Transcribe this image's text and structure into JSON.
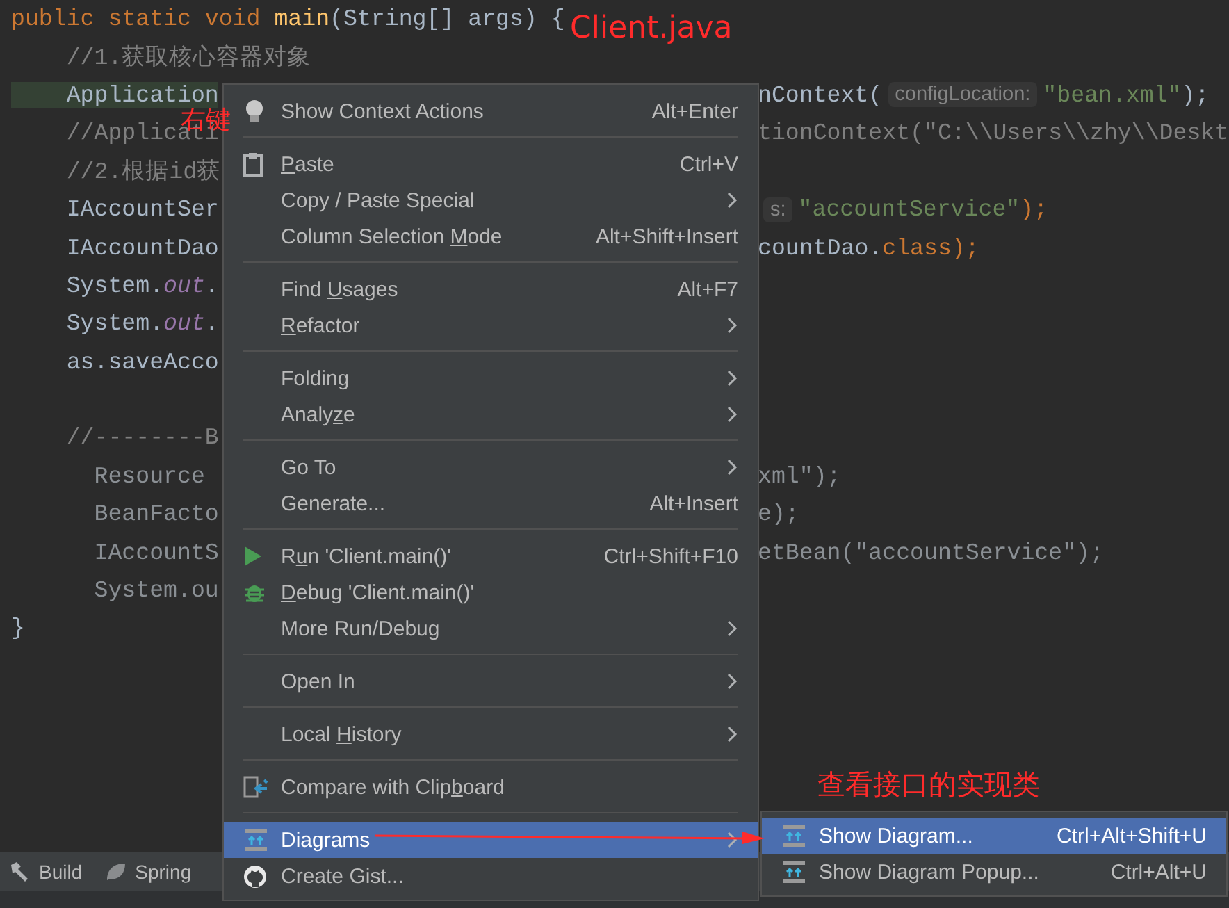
{
  "editor": {
    "lines": [
      {
        "highlighted": false,
        "left": [
          {
            "text": "public static void ",
            "kind": "keyword"
          },
          {
            "text": "main",
            "kind": "method"
          },
          {
            "text": "(String[] args) {",
            "kind": "plain"
          }
        ]
      },
      {
        "highlighted": false,
        "left": [
          {
            "text": "    //1.获取核心容器对象",
            "kind": "comment"
          }
        ]
      },
      {
        "highlighted": true,
        "left": [
          {
            "text": "    Application",
            "kind": "plain"
          }
        ],
        "right": [
          {
            "text": "nContext(",
            "kind": "plain"
          },
          {
            "text": "configLocation:",
            "kind": "hint"
          },
          {
            "text": "\"bean.xml\"",
            "kind": "string"
          },
          {
            "text": ");",
            "kind": "plain"
          }
        ]
      },
      {
        "highlighted": false,
        "left": [
          {
            "text": "    //Applicati",
            "kind": "comment"
          }
        ],
        "right": [
          {
            "text": "tionContext(\"C:\\\\Users\\\\zhy\\\\Deskt",
            "kind": "comment"
          }
        ]
      },
      {
        "highlighted": false,
        "left": [
          {
            "text": "    //2.根据id获",
            "kind": "comment"
          }
        ]
      },
      {
        "highlighted": false,
        "left": [
          {
            "text": "    IAccountSer",
            "kind": "plain"
          }
        ],
        "right": [
          {
            "text": "s:",
            "kind": "hint"
          },
          {
            "text": "\"accountService\"",
            "kind": "string"
          },
          {
            "text": ");",
            "kind": "keyword"
          }
        ]
      },
      {
        "highlighted": false,
        "left": [
          {
            "text": "    IAccountDao",
            "kind": "plain"
          }
        ],
        "right": [
          {
            "text": "countDao.",
            "kind": "plain"
          },
          {
            "text": "class",
            "kind": "keyword"
          },
          {
            "text": ");",
            "kind": "keyword"
          }
        ]
      },
      {
        "highlighted": false,
        "left": [
          {
            "text": "    System.",
            "kind": "plain"
          },
          {
            "text": "out",
            "kind": "field"
          },
          {
            "text": ".",
            "kind": "plain"
          }
        ]
      },
      {
        "highlighted": false,
        "left": [
          {
            "text": "    System.",
            "kind": "plain"
          },
          {
            "text": "out",
            "kind": "field"
          },
          {
            "text": ".",
            "kind": "plain"
          }
        ]
      },
      {
        "highlighted": false,
        "left": [
          {
            "text": "    as.saveAcco",
            "kind": "plain"
          }
        ]
      },
      {
        "highlighted": false
      },
      {
        "highlighted": false,
        "left": [
          {
            "text": "    //--------B",
            "kind": "comment"
          }
        ]
      },
      {
        "highlighted": false,
        "left": [
          {
            "text": "      Resource",
            "kind": "dim"
          }
        ],
        "right": [
          {
            "text": "xml\");",
            "kind": "dim"
          }
        ]
      },
      {
        "highlighted": false,
        "left": [
          {
            "text": "      BeanFacto",
            "kind": "dim"
          }
        ],
        "right": [
          {
            "text": "e);",
            "kind": "dim"
          }
        ]
      },
      {
        "highlighted": false,
        "left": [
          {
            "text": "      IAccountS",
            "kind": "dim"
          }
        ],
        "right": [
          {
            "text": "etBean(\"accountService\");",
            "kind": "dim"
          }
        ]
      },
      {
        "highlighted": false,
        "left": [
          {
            "text": "      System.ou",
            "kind": "dim"
          }
        ]
      },
      {
        "highlighted": false,
        "left": [
          {
            "text": "}",
            "kind": "plain"
          }
        ]
      }
    ]
  },
  "annotations": {
    "file_label": "Client.java",
    "click_label": "右键",
    "submenu_label": "查看接口的实现类"
  },
  "context_menu": {
    "items": [
      {
        "kind": "bulb",
        "label": [
          {
            "text": "Show Context Actions",
            "underlined": false
          }
        ],
        "shortcut": "Alt+Enter",
        "submenu": false,
        "selected": false
      },
      {
        "kind": "separator"
      },
      {
        "kind": "clipboard",
        "label": [
          {
            "text": "P",
            "underlined": true
          },
          {
            "text": "aste",
            "underlined": false
          }
        ],
        "shortcut": "Ctrl+V",
        "submenu": false,
        "selected": false
      },
      {
        "kind": "plain",
        "label": [
          {
            "text": "Copy / Paste Special",
            "underlined": false
          }
        ],
        "submenu": true,
        "selected": false
      },
      {
        "kind": "plain",
        "label": [
          {
            "text": "Column Selection ",
            "underlined": false
          },
          {
            "text": "M",
            "underlined": true
          },
          {
            "text": "ode",
            "underlined": false
          }
        ],
        "shortcut": "Alt+Shift+Insert",
        "submenu": false,
        "selected": false
      },
      {
        "kind": "separator"
      },
      {
        "kind": "plain",
        "label": [
          {
            "text": "Find ",
            "underlined": false
          },
          {
            "text": "U",
            "underlined": true
          },
          {
            "text": "sages",
            "underlined": false
          }
        ],
        "shortcut": "Alt+F7",
        "submenu": false,
        "selected": false
      },
      {
        "kind": "plain",
        "label": [
          {
            "text": "R",
            "underlined": true
          },
          {
            "text": "efactor",
            "underlined": false
          }
        ],
        "submenu": true,
        "selected": false
      },
      {
        "kind": "separator"
      },
      {
        "kind": "plain",
        "label": [
          {
            "text": "Folding",
            "underlined": false
          }
        ],
        "submenu": true,
        "selected": false
      },
      {
        "kind": "plain",
        "label": [
          {
            "text": "Analy",
            "underlined": false
          },
          {
            "text": "z",
            "underlined": true
          },
          {
            "text": "e",
            "underlined": false
          }
        ],
        "submenu": true,
        "selected": false
      },
      {
        "kind": "separator"
      },
      {
        "kind": "plain",
        "label": [
          {
            "text": "Go To",
            "underlined": false
          }
        ],
        "submenu": true,
        "selected": false
      },
      {
        "kind": "plain",
        "label": [
          {
            "text": "Generate...",
            "underlined": false
          }
        ],
        "shortcut": "Alt+Insert",
        "submenu": false,
        "selected": false
      },
      {
        "kind": "separator"
      },
      {
        "kind": "play",
        "label": [
          {
            "text": "R",
            "underlined": false
          },
          {
            "text": "u",
            "underlined": true
          },
          {
            "text": "n 'Client.main()'",
            "underlined": false
          }
        ],
        "shortcut": "Ctrl+Shift+F10",
        "submenu": false,
        "selected": false
      },
      {
        "kind": "bug",
        "label": [
          {
            "text": "D",
            "underlined": true
          },
          {
            "text": "ebug 'Client.main()'",
            "underlined": false
          }
        ],
        "submenu": false,
        "selected": false
      },
      {
        "kind": "plain",
        "label": [
          {
            "text": "More Run/Debug",
            "underlined": false
          }
        ],
        "submenu": true,
        "selected": false
      },
      {
        "kind": "separator"
      },
      {
        "kind": "plain",
        "label": [
          {
            "text": "Open In",
            "underlined": false
          }
        ],
        "submenu": true,
        "selected": false
      },
      {
        "kind": "separator"
      },
      {
        "kind": "plain",
        "label": [
          {
            "text": "Local ",
            "underlined": false
          },
          {
            "text": "H",
            "underlined": true
          },
          {
            "text": "istory",
            "underlined": false
          }
        ],
        "submenu": true,
        "selected": false
      },
      {
        "kind": "separator"
      },
      {
        "kind": "compare",
        "label": [
          {
            "text": "Compare with Clip",
            "underlined": false
          },
          {
            "text": "b",
            "underlined": true
          },
          {
            "text": "oard",
            "underlined": false
          }
        ],
        "submenu": false,
        "selected": false
      },
      {
        "kind": "separator"
      },
      {
        "kind": "diagram",
        "label": [
          {
            "text": "Diagrams",
            "underlined": false
          }
        ],
        "submenu": true,
        "selected": true
      },
      {
        "kind": "github",
        "label": [
          {
            "text": "Create Gist...",
            "underlined": false
          }
        ],
        "submenu": false,
        "selected": false
      }
    ]
  },
  "submenu": {
    "items": [
      {
        "kind": "diagram",
        "label": "Show Diagram...",
        "shortcut": "Ctrl+Alt+Shift+U",
        "selected": true
      },
      {
        "kind": "diagram",
        "label": "Show Diagram Popup...",
        "shortcut": "Ctrl+Alt+U",
        "selected": false
      }
    ]
  },
  "tool_strip": {
    "items": [
      {
        "kind": "hammer",
        "label": "Build"
      },
      {
        "kind": "leaf",
        "label": "Spring"
      }
    ]
  }
}
